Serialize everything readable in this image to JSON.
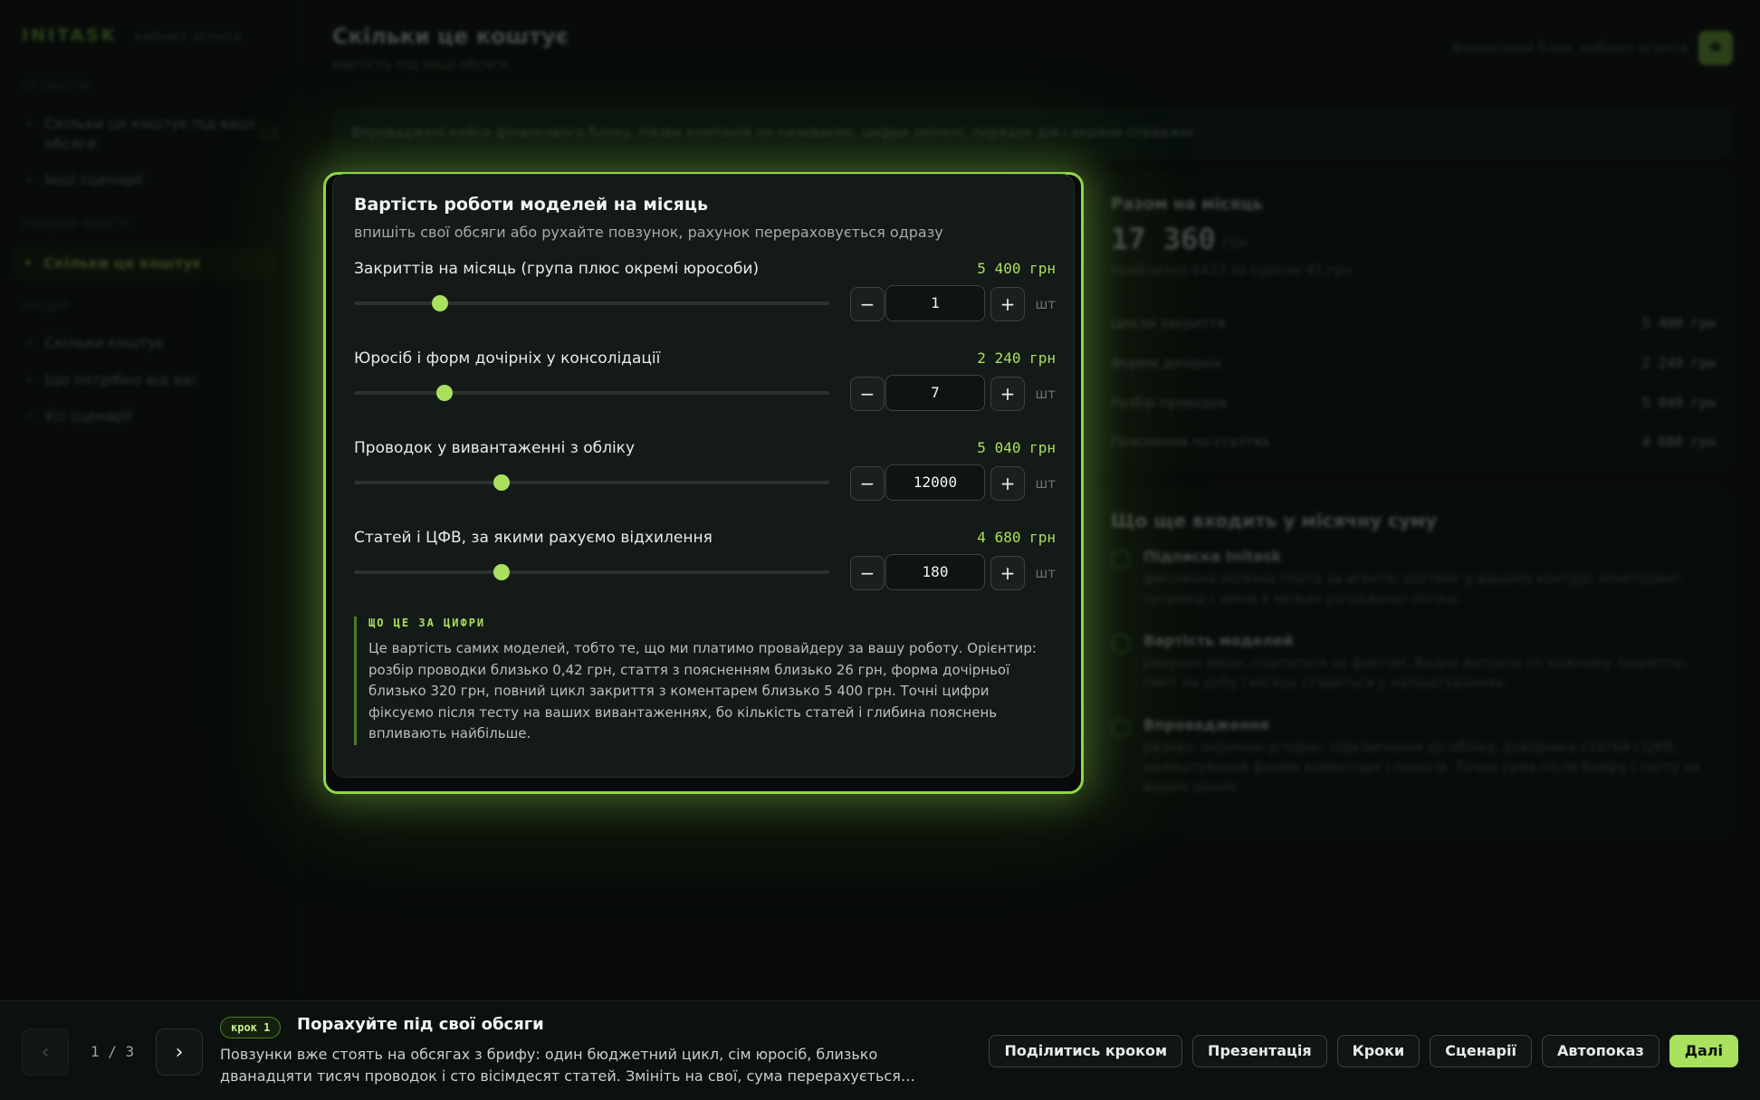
{
  "sidebar": {
    "brand": "INITASK",
    "brand_sub": "кабінет агента",
    "section1": "ОГЛЯНУТИ",
    "item1": "Скільки це коштує під ваші обсяги",
    "item1_count": "1/3",
    "item2": "Інші сценарії",
    "section2": "РОЗДІЛИ ЯКОСТІ",
    "item3": "Скільки це коштує",
    "section3": "РОЗДІЛ",
    "item4": "Скільки коштує",
    "item5": "Що потрібно від вас",
    "item6": "Усі сценарії"
  },
  "header": {
    "title": "Скільки це коштує",
    "subtitle": "вартість під ваші обсяги",
    "right_label": "Фінансовий блок, кабінет агента",
    "avatar": "Ф"
  },
  "banner": "Впроваджені кейси фінансового блоку. Назви компаній не називаємо, цифри змінені, порядок дій і екрани справжні.",
  "summary": {
    "title": "Разом на місяць",
    "total": "17 360",
    "currency": "грн",
    "note": "приблизно $423 за курсом 41 грн",
    "rows": [
      {
        "label": "Цикли закриття",
        "value": "5 400 грн"
      },
      {
        "label": "Форми дочірніх",
        "value": "2 240 грн"
      },
      {
        "label": "Розбір проводок",
        "value": "5 040 грн"
      },
      {
        "label": "Пояснення по статтях",
        "value": "4 680 грн"
      }
    ]
  },
  "includes": {
    "title": "Що ще входить у місячну суму",
    "items": [
      {
        "name": "Підписка Initask",
        "desc": "фіксована місячна плата за агента: хостинг у вашому контурі, моніторинг, супровід і зміни в межах узгодженої логіки."
      },
      {
        "name": "Вартість моделей",
        "desc": "рахунок вище, платиться за фактом. Видно витрати по кожному закриттю, ліміт на добу і місяць ставиться у налаштуваннях."
      },
      {
        "name": "Впровадження",
        "desc": "разово, окремою угодою: підключення до обліку, довідники статей і ЦФВ, налаштування форми коментаря і порогів. Точна сума після брифу і тесту на ваших даних."
      }
    ]
  },
  "calculator": {
    "title": "Вартість роботи моделей на місяць",
    "subtitle": "впишіть свої обсяги або рухайте повзунок, рахунок перераховується одразу",
    "minus": "−",
    "plus": "+",
    "rows": [
      {
        "label": "Закриттів на місяць (група плюс окремі юрособи)",
        "price": "5 400 грн",
        "value": "1",
        "unit": "шт",
        "level": 0.18
      },
      {
        "label": "Юросіб і форм дочірніх у консолідації",
        "price": "2 240 грн",
        "value": "7",
        "unit": "шт",
        "level": 0.19
      },
      {
        "label": "Проводок у вивантаженні з обліку",
        "price": "5 040 грн",
        "value": "12000",
        "unit": "шт",
        "level": 0.31
      },
      {
        "label": "Статей і ЦФВ, за якими рахуємо відхилення",
        "price": "4 680 грн",
        "value": "180",
        "unit": "шт",
        "level": 0.31
      }
    ],
    "explain_heading": "ЩО ЦЕ ЗА ЦИФРИ",
    "explain_text": "Це вартість самих моделей, тобто те, що ми платимо провайдеру за вашу роботу. Орієнтир: розбір проводки близько 0,42 грн, стаття з поясненням близько 26 грн, форма дочірньої близько 320 грн, повний цикл закриття з коментарем близько 5 400 грн. Точні цифри фіксуємо після тесту на ваших вивантаженнях, бо кількість статей і глибина пояснень впливають найбільше."
  },
  "tour": {
    "prev": "‹",
    "next": "›",
    "pager": "1 / 3",
    "step_badge": "крок 1",
    "step_title": "Порахуйте під свої обсяги",
    "step_text": "Повзунки вже стоять на обсягах з брифу: один бюджетний цикл, сім юросіб, близько дванадцяти тисяч проводок і сто вісімдесят статей. Змініть на свої, сума перерахується…",
    "actions": [
      "Поділитись кроком",
      "Презентація",
      "Кроки",
      "Сценарії",
      "Автопоказ"
    ],
    "next_label": "Далі"
  }
}
